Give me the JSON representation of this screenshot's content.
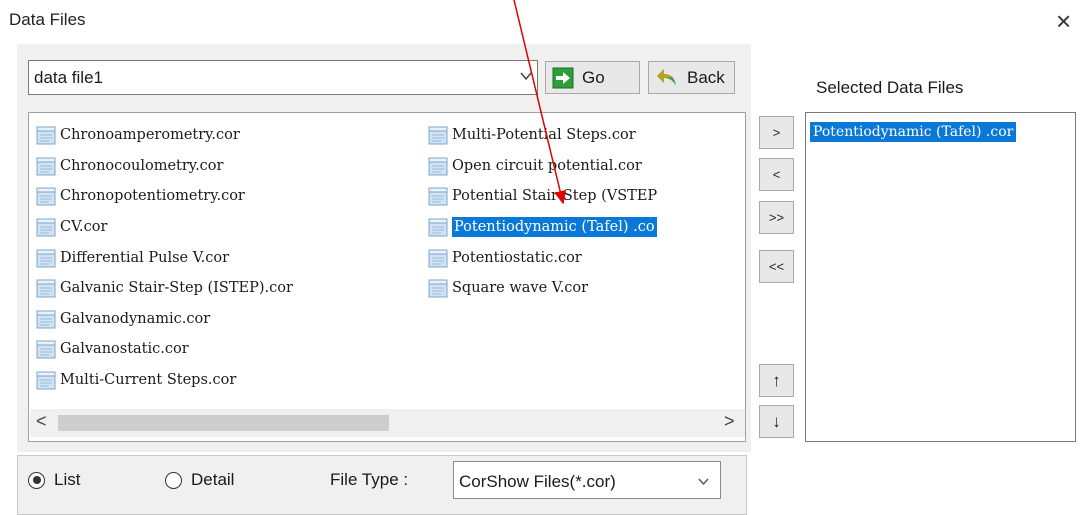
{
  "window": {
    "title": "Data Files",
    "close_glyph": "×"
  },
  "path": {
    "value": "data file1"
  },
  "toolbar": {
    "go_label": "Go",
    "back_label": "Back"
  },
  "files": {
    "col1": [
      "Chronoamperometry.cor",
      "Chronocoulometry.cor",
      "Chronopotentiometry.cor",
      "CV.cor",
      "Differential Pulse V.cor",
      "Galvanic Stair-Step (ISTEP).cor",
      "Galvanodynamic.cor",
      "Galvanostatic.cor",
      "Multi-Current Steps.cor"
    ],
    "col2": [
      "Multi-Potential Steps.cor",
      "Open circuit potential.cor",
      "Potential Stair-Step (VSTEP",
      "Potentiodynamic (Tafel) .co",
      "Potentiostatic.cor",
      "Square wave V.cor"
    ],
    "selected_file": "Potentiodynamic (Tafel) .co"
  },
  "scroll": {
    "left_arrow": "<",
    "right_arrow": ">"
  },
  "move_buttons": {
    "add": ">",
    "remove": "<",
    "add_all": ">>",
    "remove_all": "<<",
    "up": "↑",
    "down": "↓"
  },
  "selected_panel": {
    "title": "Selected Data Files",
    "items": [
      "Potentiodynamic (Tafel) .cor"
    ]
  },
  "view_options": {
    "list_label": "List",
    "detail_label": "Detail",
    "list_checked": true,
    "file_type_label": "File Type :",
    "file_type_value": "CorShow Files(*.cor)"
  },
  "colors": {
    "selection": "#0a78d7",
    "annotation_arrow": "#e00000",
    "panel_bg": "#f0f0f0"
  },
  "icons": [
    "folder-file-icon",
    "go-arrow-icon",
    "back-arrow-icon",
    "chevron-down-icon"
  ]
}
